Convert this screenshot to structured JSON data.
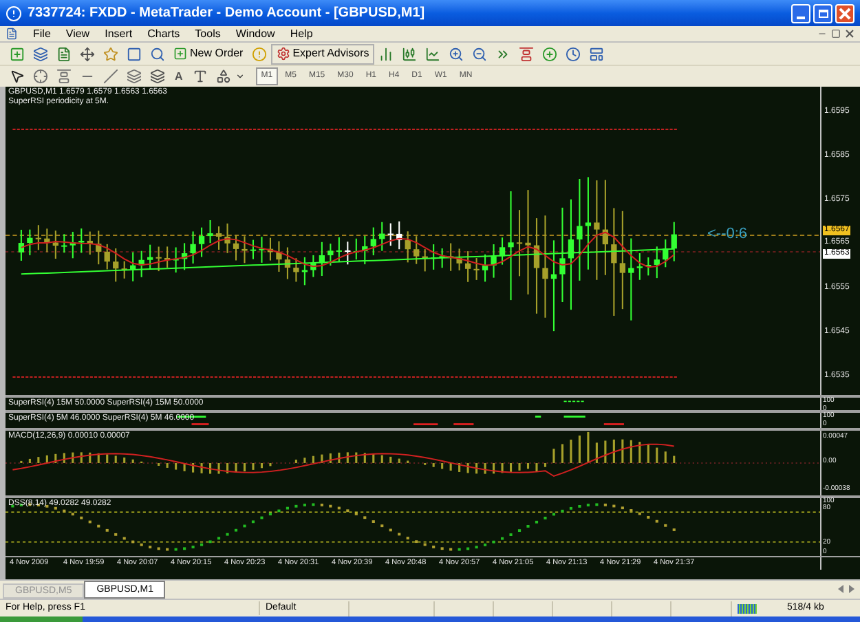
{
  "window": {
    "title": "7337724: FXDD - MetaTrader - Demo Account - [GBPUSD,M1]"
  },
  "menu": [
    "File",
    "View",
    "Insert",
    "Charts",
    "Tools",
    "Window",
    "Help"
  ],
  "toolbar": {
    "new_order": "New Order",
    "expert_advisors": "Expert Advisors",
    "text_tool": "A"
  },
  "periods": [
    {
      "label": "M1",
      "selected": true
    },
    {
      "label": "M5",
      "selected": false
    },
    {
      "label": "M15",
      "selected": false
    },
    {
      "label": "M30",
      "selected": false
    },
    {
      "label": "H1",
      "selected": false
    },
    {
      "label": "H4",
      "selected": false
    },
    {
      "label": "D1",
      "selected": false
    },
    {
      "label": "W1",
      "selected": false
    },
    {
      "label": "MN",
      "selected": false
    }
  ],
  "main_pane": {
    "header": [
      "GBPUSD,M1  1.6579 1.6579 1.6563 1.6563",
      "SuperRSI periodicity at 5M."
    ],
    "annotation": "<--0:6",
    "axis": [
      {
        "label": "1.6595",
        "kind": "tick"
      },
      {
        "label": "1.6585",
        "kind": "tick"
      },
      {
        "label": "1.6575",
        "kind": "tick"
      },
      {
        "label": "1.6567",
        "kind": "ask"
      },
      {
        "label": "1.6565",
        "kind": "tick"
      },
      {
        "label": "1.6563",
        "kind": "bid"
      },
      {
        "label": "1.6555",
        "kind": "tick"
      },
      {
        "label": "1.6545",
        "kind": "tick"
      },
      {
        "label": "1.6535",
        "kind": "tick"
      }
    ]
  },
  "indicator_panes": [
    {
      "header": "SuperRSI(4) 15M 50.0000  SuperRSI(4) 15M 50.0000",
      "axis": [
        "100",
        "0"
      ],
      "kind": "rsi15"
    },
    {
      "header": "SuperRSI(4) 5M 46.0000  SuperRSI(4) 5M 46.0000",
      "axis": [
        "100",
        "0"
      ],
      "kind": "rsi5"
    },
    {
      "header": "MACD(12,26,9) 0.00010  0.00007",
      "axis": [
        "0.00047",
        "0.00",
        "-0.00038"
      ],
      "kind": "macd"
    },
    {
      "header": "DSS(8,14) 49.0282 49.0282",
      "axis": [
        "100",
        "80",
        "20",
        "0"
      ],
      "kind": "dss"
    }
  ],
  "time_axis": [
    "4 Nov 2009",
    "4 Nov 19:59",
    "4 Nov 20:07",
    "4 Nov 20:15",
    "4 Nov 20:23",
    "4 Nov 20:31",
    "4 Nov 20:39",
    "4 Nov 20:48",
    "4 Nov 20:57",
    "4 Nov 21:05",
    "4 Nov 21:13",
    "4 Nov 21:29",
    "4 Nov 21:37"
  ],
  "chart_tabs": [
    {
      "label": "GBPUSD,M5",
      "selected": false
    },
    {
      "label": "GBPUSD,M1",
      "selected": true
    }
  ],
  "status_bar": {
    "help": "For Help, press F1",
    "profile": "Default",
    "traffic": "518/4 kb"
  }
}
